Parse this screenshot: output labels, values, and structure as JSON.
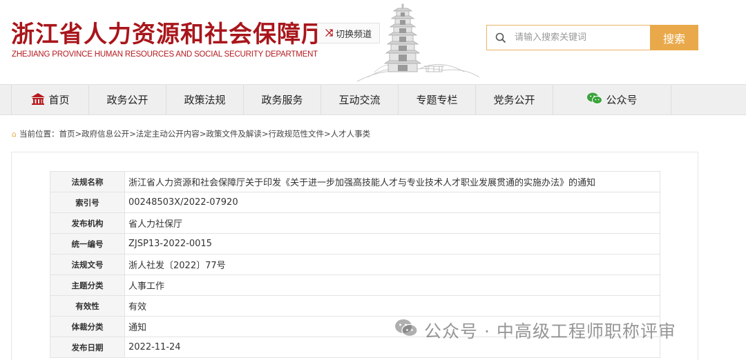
{
  "header": {
    "title": "浙江省人力资源和社会保障厅",
    "subtitle": "ZHEJIANG PROVINCE HUMAN RESOURCES AND SOCIAL SECURITY DEPARTMENT",
    "switch_label": "切换频道",
    "search_placeholder": "请输入搜索关键词",
    "search_button": "搜索"
  },
  "nav": {
    "items": [
      {
        "label": "首页",
        "icon": "home-icon"
      },
      {
        "label": "政务公开"
      },
      {
        "label": "政策法规"
      },
      {
        "label": "政务服务"
      },
      {
        "label": "互动交流"
      },
      {
        "label": "专题专栏"
      },
      {
        "label": "党务公开"
      },
      {
        "label": "公众号",
        "icon": "wechat-icon"
      }
    ]
  },
  "breadcrumb": {
    "prefix": "当前位置：",
    "path": "首页>政府信息公开>法定主动公开内容>政策文件及解读>行政规范性文件>人才人事类"
  },
  "info_table": {
    "rows": [
      {
        "label": "法规名称",
        "value": "浙江省人力资源和社会保障厅关于印发《关于进一步加强高技能人才与专业技术人才职业发展贯通的实施办法》的通知"
      },
      {
        "label": "索引号",
        "value": "00248503X/2022-07920"
      },
      {
        "label": "发布机构",
        "value": "省人力社保厅"
      },
      {
        "label": "统一编号",
        "value": "ZJSP13-2022-0015"
      },
      {
        "label": "法规文号",
        "value": "浙人社发〔2022〕77号"
      },
      {
        "label": "主题分类",
        "value": "人事工作"
      },
      {
        "label": "有效性",
        "value": "有效"
      },
      {
        "label": "体裁分类",
        "value": "通知"
      },
      {
        "label": "发布日期",
        "value": "2022-11-24"
      }
    ]
  },
  "watermark": {
    "text": "公众号 · 中高级工程师职称评审"
  },
  "colors": {
    "brand_red": "#a8161b",
    "accent_orange": "#e9a94b",
    "nav_bg": "#efefef"
  }
}
